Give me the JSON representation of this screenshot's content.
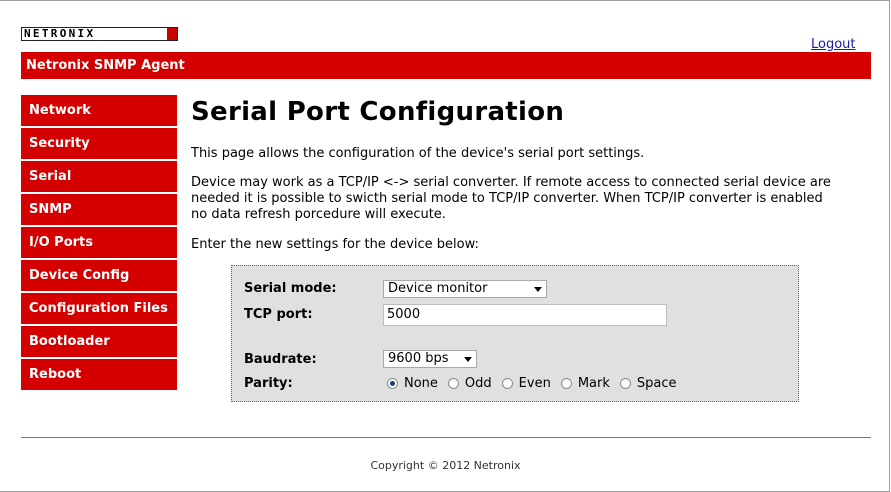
{
  "header": {
    "logo_text": "NETRONIX",
    "logout_label": "Logout",
    "banner_title": "Netronix SNMP Agent"
  },
  "sidebar": {
    "items": [
      {
        "label": "Network"
      },
      {
        "label": "Security"
      },
      {
        "label": "Serial"
      },
      {
        "label": "SNMP"
      },
      {
        "label": "I/O Ports"
      },
      {
        "label": "Device Config"
      },
      {
        "label": "Configuration Files"
      },
      {
        "label": "Bootloader"
      },
      {
        "label": "Reboot"
      }
    ]
  },
  "main": {
    "title": "Serial Port Configuration",
    "intro": "This page allows the configuration of the device's serial port settings.",
    "description": "Device may work as a TCP/IP <-> serial converter. If remote access to connected serial device are needed it is possible to swicth serial mode to TCP/IP converter. When TCP/IP converter is enabled no data refresh porcedure will execute.",
    "prompt": "Enter the new settings for the device below:"
  },
  "form": {
    "serial_mode_label": "Serial mode:",
    "serial_mode_value": "Device monitor",
    "tcp_port_label": "TCP port:",
    "tcp_port_value": "5000",
    "baudrate_label": "Baudrate:",
    "baudrate_value": "9600 bps",
    "parity_label": "Parity:",
    "parity_options": [
      {
        "label": "None",
        "checked": true
      },
      {
        "label": "Odd",
        "checked": false
      },
      {
        "label": "Even",
        "checked": false
      },
      {
        "label": "Mark",
        "checked": false
      },
      {
        "label": "Space",
        "checked": false
      }
    ]
  },
  "footer": {
    "copyright": "Copyright © 2012 Netronix"
  },
  "colors": {
    "brand_red": "#d40000",
    "panel_gray": "#e0e0e0",
    "link_blue": "#1a1aa6"
  }
}
